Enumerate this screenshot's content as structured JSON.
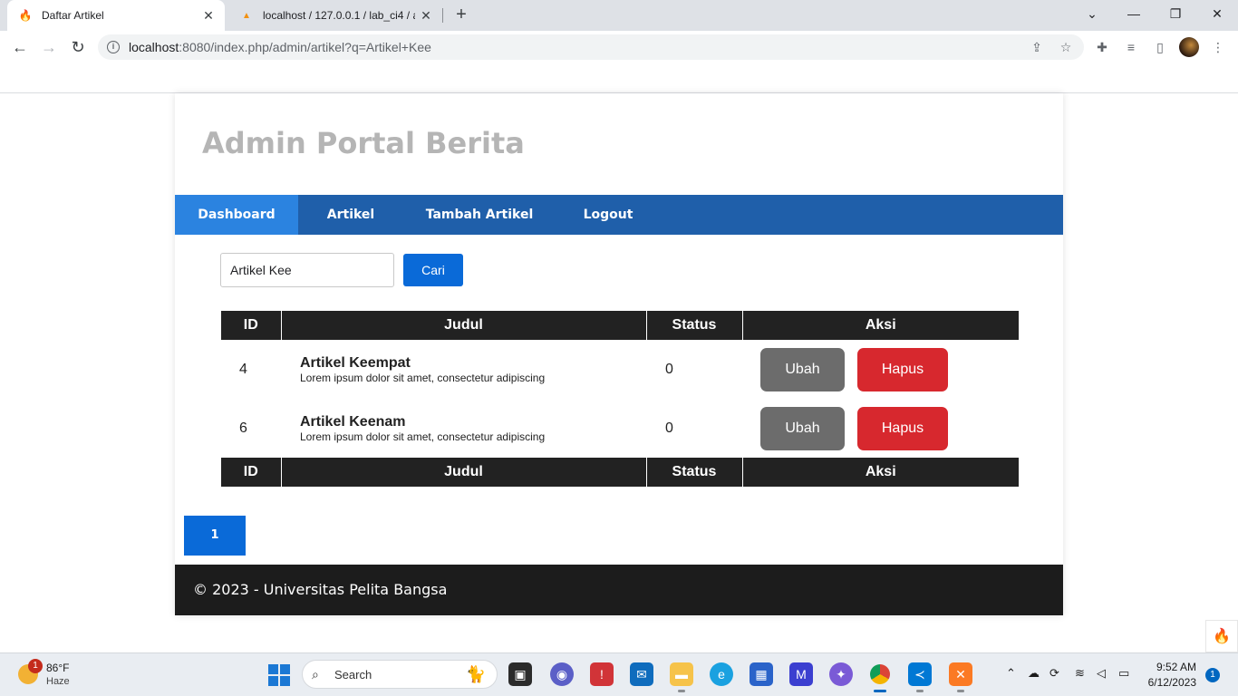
{
  "browser": {
    "tabs": [
      {
        "title": "Daftar Artikel",
        "active": true,
        "favicon": "codeigniter-flame-icon"
      },
      {
        "title": "localhost / 127.0.0.1 / lab_ci4 / ar",
        "active": false,
        "favicon": "phpmyadmin-icon"
      }
    ],
    "url_host": "localhost",
    "url_path": ":8080/index.php/admin/artikel?q=Artikel+Kee"
  },
  "site": {
    "title": "Admin Portal Berita",
    "nav": [
      {
        "label": "Dashboard",
        "active": true
      },
      {
        "label": "Artikel",
        "active": false
      },
      {
        "label": "Tambah Artikel",
        "active": false
      },
      {
        "label": "Logout",
        "active": false
      }
    ]
  },
  "search": {
    "value": "Artikel Kee",
    "button_label": "Cari"
  },
  "table": {
    "columns": [
      "ID",
      "Judul",
      "Status",
      "Aksi"
    ],
    "rows": [
      {
        "id": "4",
        "title": "Artikel Keempat",
        "summary": "Lorem ipsum dolor sit amet, consectetur adipiscing",
        "status": "0",
        "edit_label": "Ubah",
        "delete_label": "Hapus"
      },
      {
        "id": "6",
        "title": "Artikel Keenam",
        "summary": "Lorem ipsum dolor sit amet, consectetur adipiscing",
        "status": "0",
        "edit_label": "Ubah",
        "delete_label": "Hapus"
      }
    ]
  },
  "pagination": {
    "current": "1"
  },
  "footer": {
    "text": "© 2023 - Universitas Pelita Bangsa"
  },
  "taskbar": {
    "weather_temp": "86°F",
    "weather_desc": "Haze",
    "weather_badge": "1",
    "search_label": "Search",
    "time": "9:52 AM",
    "date": "6/12/2023",
    "notification_count": "1"
  },
  "colors": {
    "nav_bg": "#1f5faa",
    "nav_active": "#2b83e0",
    "primary_button": "#0a6ad8",
    "edit_button": "#6c6c6c",
    "delete_button": "#d7282e",
    "table_header": "#222222",
    "footer_bg": "#1c1c1c",
    "site_title": "#b5b5b5"
  }
}
